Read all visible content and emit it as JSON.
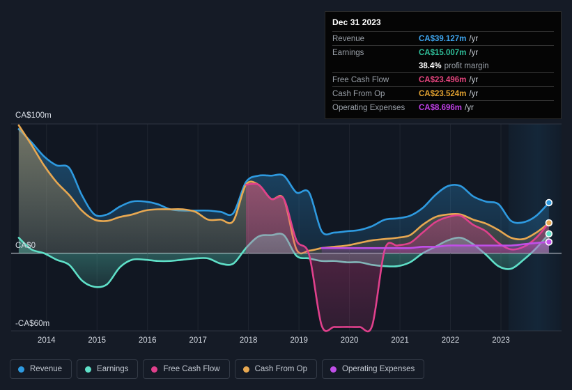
{
  "chart_data": {
    "type": "area",
    "title": "",
    "xlabel": "",
    "ylabel": "",
    "currency": "CA$",
    "units": "m",
    "grid": true,
    "legend_position": "bottom",
    "xlim": [
      2013.3,
      2024.2
    ],
    "ylim": [
      -60,
      100
    ],
    "yticks": [
      100,
      0,
      -60
    ],
    "ytick_labels": [
      "CA$100m",
      "CA$0",
      "-CA$60m"
    ],
    "xticks": [
      2014,
      2015,
      2016,
      2017,
      2018,
      2019,
      2020,
      2021,
      2022,
      2023
    ],
    "xtick_labels": [
      "2014",
      "2015",
      "2016",
      "2017",
      "2018",
      "2019",
      "2020",
      "2021",
      "2022",
      "2023"
    ],
    "forecast_band": {
      "start": 2023.15,
      "end": 2024.2,
      "label": ""
    },
    "x": [
      2013.45,
      2013.7,
      2013.95,
      2014.2,
      2014.45,
      2014.7,
      2014.95,
      2015.2,
      2015.45,
      2015.7,
      2015.95,
      2016.2,
      2016.45,
      2016.7,
      2016.95,
      2017.2,
      2017.45,
      2017.7,
      2017.95,
      2018.2,
      2018.45,
      2018.7,
      2018.95,
      2019.2,
      2019.45,
      2019.7,
      2019.95,
      2020.2,
      2020.45,
      2020.7,
      2020.95,
      2021.2,
      2021.45,
      2021.7,
      2021.95,
      2022.2,
      2022.45,
      2022.7,
      2022.95,
      2023.2,
      2023.45,
      2023.7,
      2023.95
    ],
    "series": [
      {
        "name": "Revenue",
        "color": "#2e9ae0",
        "key": "revenue",
        "values": [
          96,
          86,
          75,
          68,
          66,
          45,
          30,
          30,
          36,
          40,
          40,
          38,
          34,
          33,
          33,
          33,
          32,
          31,
          55,
          60,
          60,
          60,
          47,
          47,
          17,
          16,
          17,
          18,
          21,
          26,
          27,
          29,
          35,
          45,
          52,
          52,
          44,
          40,
          38,
          25,
          24,
          29,
          39.127
        ]
      },
      {
        "name": "Earnings",
        "color": "#5fe0c8",
        "key": "earnings",
        "values": [
          12,
          3,
          0,
          -5,
          -9,
          -21,
          -26,
          -24,
          -11,
          -5,
          -5,
          -6,
          -6,
          -5,
          -4,
          -4,
          -8,
          -8,
          4,
          13,
          14,
          14,
          -2,
          -4,
          -6,
          -6,
          -7,
          -7,
          -9,
          -10,
          -10,
          -7,
          0,
          5,
          10,
          12,
          7,
          -1,
          -10,
          -12,
          -5,
          4,
          15.007
        ]
      },
      {
        "name": "Free Cash Flow",
        "color": "#e0408c",
        "key": "free_cash_flow",
        "values": [
          null,
          null,
          null,
          null,
          null,
          null,
          null,
          null,
          null,
          null,
          null,
          null,
          null,
          null,
          null,
          null,
          null,
          null,
          53,
          53,
          42,
          42,
          10,
          -1,
          -56,
          -57,
          -57,
          -57,
          -56,
          3,
          6,
          8,
          16,
          24,
          28,
          29,
          22,
          17,
          8,
          3,
          5,
          12,
          23.496
        ]
      },
      {
        "name": "Cash From Op",
        "color": "#e8a851",
        "key": "cash_from_op",
        "values": [
          99,
          84,
          68,
          55,
          45,
          33,
          26,
          25,
          28,
          30,
          33,
          34,
          34,
          34,
          32,
          26,
          26,
          25,
          53,
          53,
          42,
          42,
          3,
          2,
          4,
          5,
          6,
          8,
          10,
          11,
          12,
          14,
          22,
          28,
          30,
          30,
          26,
          23,
          18,
          12,
          11,
          16,
          23.524
        ]
      },
      {
        "name": "Operating Expenses",
        "color": "#c04fe8",
        "key": "operating_expenses",
        "values": [
          null,
          null,
          null,
          null,
          null,
          null,
          null,
          null,
          null,
          null,
          null,
          null,
          null,
          null,
          null,
          null,
          null,
          null,
          null,
          null,
          null,
          null,
          null,
          null,
          4,
          4,
          4,
          4,
          4,
          4,
          4,
          4,
          5,
          5,
          6,
          6,
          6,
          6,
          6,
          6,
          7,
          8,
          8.696
        ]
      }
    ]
  },
  "yaxis": {
    "top_label": "CA$100m",
    "zero_label": "CA$0",
    "bottom_label": "-CA$60m"
  },
  "tooltip": {
    "date": "Dec 31 2023",
    "unit_suffix": "/yr",
    "rows": [
      {
        "label": "Revenue",
        "value": "CA$39.127m",
        "unit": "/yr",
        "color": "#3ea6f0"
      },
      {
        "label": "Earnings",
        "value": "CA$15.007m",
        "unit": "/yr",
        "color": "#2fbf9a"
      },
      {
        "label": "Free Cash Flow",
        "value": "CA$23.496m",
        "unit": "/yr",
        "color": "#e8457f"
      },
      {
        "label": "Cash From Op",
        "value": "CA$23.524m",
        "unit": "/yr",
        "color": "#e0a030"
      },
      {
        "label": "Operating Expenses",
        "value": "CA$8.696m",
        "unit": "/yr",
        "color": "#c040e8"
      }
    ],
    "profit_margin_value": "38.4%",
    "profit_margin_label": "profit margin"
  },
  "legend": {
    "items": [
      {
        "label": "Revenue",
        "color": "#2e9ae0"
      },
      {
        "label": "Earnings",
        "color": "#5fe0c8"
      },
      {
        "label": "Free Cash Flow",
        "color": "#e0408c"
      },
      {
        "label": "Cash From Op",
        "color": "#e8a851"
      },
      {
        "label": "Operating Expenses",
        "color": "#c04fe8"
      }
    ]
  }
}
